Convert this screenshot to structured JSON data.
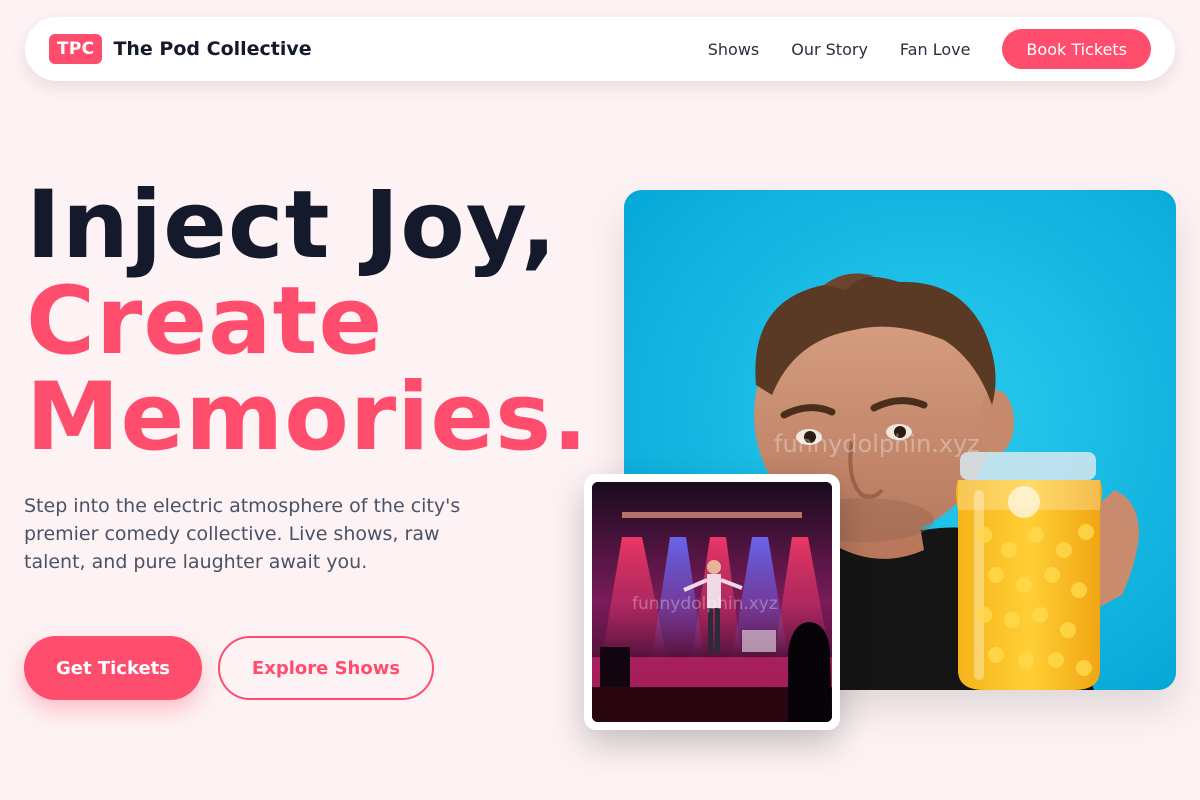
{
  "nav": {
    "logo_text": "TPC",
    "brand_name": "The Pod Collective",
    "links": [
      "Shows",
      "Our Story",
      "Fan Love"
    ],
    "cta_label": "Book Tickets"
  },
  "hero": {
    "headline_line1": "Inject Joy,",
    "headline_line2": "Create",
    "headline_line3": "Memories.",
    "subtext": "Step into the electric atmosphere of the city's premier comedy collective. Live shows, raw talent, and pure laughter await you.",
    "primary_button": "Get Tickets",
    "secondary_button": "Explore Shows"
  },
  "images": {
    "main_watermark": "funnydolphin.xyz",
    "stage_watermark": "funnydolphin.xyz"
  },
  "colors": {
    "accent": "#ff4d6d",
    "page_bg": "#fdf3f4",
    "heading": "#141a2b",
    "photo_bg": "#0ab4e0"
  }
}
